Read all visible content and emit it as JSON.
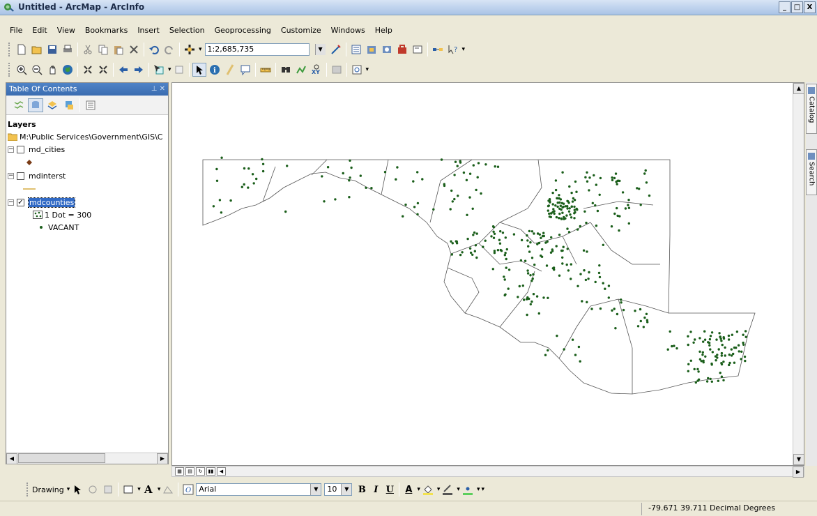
{
  "window": {
    "title": "Untitled - ArcMap - ArcInfo",
    "buttons": [
      "_",
      "□",
      "X"
    ]
  },
  "menu": [
    "File",
    "Edit",
    "View",
    "Bookmarks",
    "Insert",
    "Selection",
    "Geoprocessing",
    "Customize",
    "Windows",
    "Help"
  ],
  "standard_toolbar": {
    "scale": "1:2,685,735",
    "icons": [
      "new-icon",
      "open-icon",
      "save-icon",
      "print-icon",
      "cut-icon",
      "copy-icon",
      "paste-icon",
      "delete-icon",
      "undo-icon",
      "redo-icon",
      "add-data-icon",
      "editor-icon",
      "toc-icon",
      "catalog-icon",
      "search-icon",
      "arctoolbox-icon",
      "python-icon",
      "modelbuilder-icon",
      "whats-this-icon"
    ]
  },
  "tools_toolbar": {
    "icons": [
      "zoom-in-icon",
      "zoom-out-icon",
      "pan-icon",
      "full-extent-icon",
      "fixed-zoom-in-icon",
      "fixed-zoom-out-icon",
      "back-extent-icon",
      "forward-extent-icon",
      "select-features-icon",
      "clear-selection-icon",
      "select-elements-icon",
      "identify-icon",
      "hyperlink-icon",
      "html-popup-icon",
      "measure-icon",
      "find-icon",
      "find-route-icon",
      "goto-xy-icon",
      "time-slider-icon",
      "viewer-window-icon"
    ]
  },
  "toc": {
    "title": "Table Of Contents",
    "pin": "⊥ ✕",
    "root_label": "Layers",
    "root_path": "M:\\Public Services\\Government\\GIS\\C",
    "layers": [
      {
        "name": "md_cities",
        "checked": false,
        "symbol": "diamond",
        "color": "#7a3b16"
      },
      {
        "name": "mdinterst",
        "checked": false,
        "symbol": "line",
        "color": "#e0c070"
      },
      {
        "name": "mdcounties",
        "checked": true,
        "selected": true,
        "legend_title": "1 Dot = 300",
        "legend_item": "VACANT",
        "color": "#1a5e1a"
      }
    ]
  },
  "dock_tabs": [
    "Catalog",
    "Search"
  ],
  "drawing_toolbar": {
    "label": "Drawing",
    "font": "Arial",
    "size": "10",
    "bold": "B",
    "italic": "I",
    "underline": "U",
    "font_color_label": "A"
  },
  "status": {
    "coordinates": "-79.671  39.711 Decimal Degrees"
  },
  "colors": {
    "dot": "#1a5e1a",
    "outline": "#555555",
    "selection": "#316ac5"
  }
}
